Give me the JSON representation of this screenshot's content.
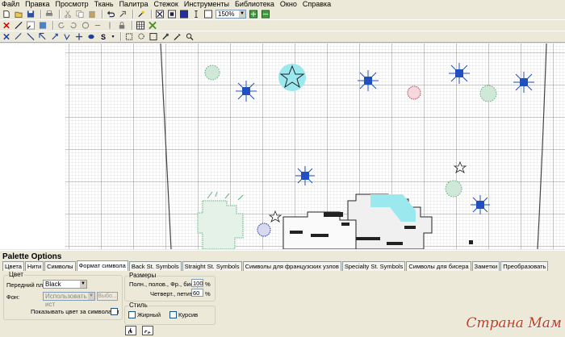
{
  "menu": [
    "Файл",
    "Правка",
    "Просмотр",
    "Ткань",
    "Палитра",
    "Стежок",
    "Инструменты",
    "Библиотека",
    "Окно",
    "Справка"
  ],
  "toolbar": {
    "zoom": "150%"
  },
  "palette": {
    "title": "Palette Options",
    "tabs": [
      "Цвета",
      "Нити",
      "Символы",
      "Формат символа",
      "Back St. Symbols",
      "Straight St. Symbols",
      "Символы для французских узлов",
      "Specialty St. Symbols",
      "Символы для бисера",
      "Заметки",
      "Преобразовать"
    ],
    "active_tab": "Формат символа",
    "color_group": {
      "legend": "Цвет",
      "foreground_label": "Передний план:",
      "foreground_value": "Black",
      "background_label": "Фон:",
      "background_value": "Использовать ист",
      "choose_button": "Выбо...",
      "show_color_label": "Показывать цвет за символами"
    },
    "sizes_group": {
      "legend": "Размеры",
      "full_label": "Полн., полов., Фр., бисер:",
      "full_value": "100",
      "quarter_label": "Четверт., петит,",
      "quarter_value": "60",
      "unit": "%"
    },
    "style_group": {
      "legend": "Стиль",
      "bold_label": "Жирный",
      "italic_label": "Курсив"
    }
  },
  "watermark": "Страна Мам",
  "colors": {
    "aqua": "#9be8ef",
    "blue": "#2050c0",
    "green": "#60b080"
  }
}
